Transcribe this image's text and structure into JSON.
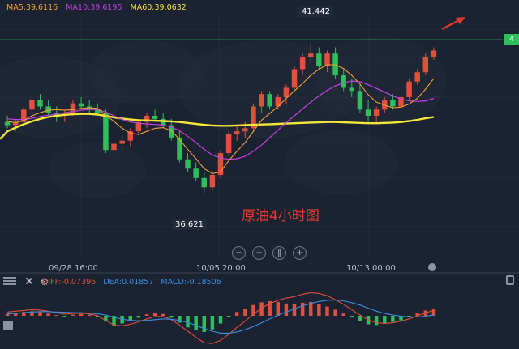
{
  "legend": {
    "ma5": "MA5:39.6116",
    "ma10": "MA10:39.6195",
    "ma60": "MA60:39.0632",
    "colors": {
      "ma5": "#f0a030",
      "ma10": "#c040e0",
      "ma60": "#f5e63a"
    }
  },
  "macd_legend": {
    "diff": "DIFF:-0.07396",
    "dea": "DEA:0.01857",
    "macd": "MACD:-0.18506",
    "colors": {
      "diff": "#e0503a",
      "dea": "#3a8ee0",
      "macd": "#3a8ee0"
    }
  },
  "annotations": {
    "high": "41.442",
    "low": "36.621",
    "title": "原油4小时图",
    "price_tag": "4"
  },
  "x_axis_labels": [
    "09/28 16:00",
    "10/05 20:00",
    "10/13 00:00"
  ],
  "colors": {
    "up": "#e0503a",
    "down": "#2fbf5a",
    "background": "#1b2232",
    "arrow": "#e03a2f"
  },
  "zoom_controls": [
    "−",
    "+",
    "‖",
    "+"
  ],
  "chart_data": {
    "type": "candlestick",
    "ylim": [
      36.0,
      42.2
    ],
    "candles": [
      [
        38.9,
        39.1,
        38.7,
        38.8
      ],
      [
        38.8,
        39.0,
        38.6,
        38.9
      ],
      [
        38.9,
        39.4,
        38.8,
        39.3
      ],
      [
        39.3,
        39.7,
        39.1,
        39.6
      ],
      [
        39.6,
        39.8,
        39.3,
        39.4
      ],
      [
        39.4,
        39.6,
        39.1,
        39.2
      ],
      [
        39.2,
        39.4,
        38.9,
        39.1
      ],
      [
        39.1,
        39.3,
        38.9,
        39.2
      ],
      [
        39.2,
        39.6,
        39.1,
        39.5
      ],
      [
        39.5,
        39.7,
        39.3,
        39.4
      ],
      [
        39.4,
        39.6,
        39.2,
        39.3
      ],
      [
        39.3,
        39.5,
        39.1,
        39.2
      ],
      [
        39.2,
        39.3,
        37.9,
        38.0
      ],
      [
        38.0,
        38.3,
        37.8,
        38.2
      ],
      [
        38.2,
        38.5,
        38.0,
        38.3
      ],
      [
        38.3,
        38.7,
        38.1,
        38.6
      ],
      [
        38.6,
        39.0,
        38.5,
        38.9
      ],
      [
        38.9,
        39.2,
        38.7,
        39.1
      ],
      [
        39.1,
        39.3,
        38.9,
        39.0
      ],
      [
        39.0,
        39.2,
        38.7,
        38.8
      ],
      [
        38.8,
        39.0,
        38.3,
        38.4
      ],
      [
        38.4,
        38.6,
        37.6,
        37.7
      ],
      [
        37.7,
        37.9,
        37.3,
        37.4
      ],
      [
        37.4,
        37.6,
        37.0,
        37.1
      ],
      [
        37.1,
        37.3,
        36.62,
        36.8
      ],
      [
        36.8,
        37.3,
        36.7,
        37.2
      ],
      [
        37.2,
        38.0,
        37.1,
        37.9
      ],
      [
        37.9,
        38.6,
        37.8,
        38.5
      ],
      [
        38.5,
        38.8,
        38.3,
        38.6
      ],
      [
        38.6,
        38.9,
        38.4,
        38.7
      ],
      [
        38.7,
        39.5,
        38.6,
        39.4
      ],
      [
        39.4,
        39.9,
        39.2,
        39.8
      ],
      [
        39.8,
        39.9,
        39.3,
        39.4
      ],
      [
        39.4,
        39.8,
        39.3,
        39.7
      ],
      [
        39.7,
        40.1,
        39.5,
        40.0
      ],
      [
        40.0,
        40.7,
        39.9,
        40.6
      ],
      [
        40.6,
        41.1,
        40.4,
        41.0
      ],
      [
        41.0,
        41.44,
        40.8,
        41.1
      ],
      [
        41.1,
        41.3,
        40.6,
        40.7
      ],
      [
        40.7,
        41.2,
        40.5,
        41.1
      ],
      [
        41.1,
        41.3,
        40.3,
        40.4
      ],
      [
        40.4,
        40.6,
        39.9,
        40.0
      ],
      [
        40.0,
        40.3,
        39.7,
        39.9
      ],
      [
        39.9,
        40.1,
        39.2,
        39.3
      ],
      [
        39.3,
        39.6,
        38.9,
        39.1
      ],
      [
        39.1,
        39.4,
        38.9,
        39.3
      ],
      [
        39.3,
        39.7,
        39.2,
        39.6
      ],
      [
        39.6,
        39.8,
        39.3,
        39.4
      ],
      [
        39.4,
        39.8,
        39.3,
        39.7
      ],
      [
        39.7,
        40.3,
        39.6,
        40.2
      ],
      [
        40.2,
        40.6,
        40.1,
        40.5
      ],
      [
        40.5,
        41.1,
        40.4,
        41.0
      ],
      [
        41.0,
        41.3,
        40.9,
        41.2
      ]
    ],
    "ma5": [
      38.92,
      38.88,
      38.95,
      39.1,
      39.2,
      39.28,
      39.3,
      39.28,
      39.3,
      39.34,
      39.36,
      39.34,
      39.12,
      38.92,
      38.7,
      38.54,
      38.5,
      38.6,
      38.7,
      38.72,
      38.62,
      38.34,
      38.02,
      37.72,
      37.4,
      37.24,
      37.3,
      37.66,
      37.96,
      38.24,
      38.6,
      38.96,
      39.18,
      39.4,
      39.66,
      39.9,
      40.14,
      40.4,
      40.6,
      40.74,
      40.74,
      40.62,
      40.4,
      40.12,
      39.78,
      39.54,
      39.44,
      39.36,
      39.38,
      39.48,
      39.66,
      39.96,
      40.3
    ],
    "ma10": [
      39.0,
      38.98,
      38.98,
      39.02,
      39.08,
      39.12,
      39.16,
      39.2,
      39.24,
      39.28,
      39.3,
      39.3,
      39.22,
      39.1,
      38.98,
      38.9,
      38.86,
      38.84,
      38.82,
      38.8,
      38.74,
      38.62,
      38.44,
      38.24,
      38.02,
      37.84,
      37.74,
      37.7,
      37.72,
      37.8,
      37.96,
      38.16,
      38.4,
      38.64,
      38.88,
      39.1,
      39.32,
      39.54,
      39.74,
      39.92,
      40.06,
      40.16,
      40.22,
      40.2,
      40.1,
      39.98,
      39.86,
      39.74,
      39.64,
      39.58,
      39.56,
      39.58,
      39.66
    ],
    "ma60": [
      38.6,
      38.72,
      38.83,
      38.92,
      39.0,
      39.06,
      39.1,
      39.13,
      39.15,
      39.16,
      39.16,
      39.14,
      39.1,
      39.05,
      39.01,
      38.98,
      38.96,
      38.95,
      38.94,
      38.93,
      38.92,
      38.9,
      38.87,
      38.84,
      38.81,
      38.79,
      38.78,
      38.78,
      38.79,
      38.8,
      38.81,
      38.82,
      38.83,
      38.84,
      38.85,
      38.86,
      38.87,
      38.88,
      38.89,
      38.9,
      38.9,
      38.89,
      38.88,
      38.87,
      38.86,
      38.86,
      38.87,
      38.88,
      38.9,
      38.93,
      38.97,
      39.02,
      39.06
    ],
    "macd_hist": [
      0.05,
      0.08,
      0.1,
      0.12,
      0.1,
      0.06,
      0.02,
      -0.02,
      0.03,
      0.05,
      0.03,
      -0.02,
      -0.15,
      -0.25,
      -0.2,
      -0.12,
      -0.05,
      0.04,
      0.08,
      0.05,
      -0.05,
      -0.18,
      -0.3,
      -0.38,
      -0.42,
      -0.35,
      -0.2,
      -0.02,
      0.1,
      0.18,
      0.28,
      0.35,
      0.38,
      0.36,
      0.32,
      0.3,
      0.34,
      0.36,
      0.3,
      0.24,
      0.16,
      0.06,
      -0.04,
      -0.14,
      -0.22,
      -0.24,
      -0.2,
      -0.16,
      -0.12,
      -0.04,
      0.06,
      0.14,
      0.18
    ],
    "diff": [
      0.1,
      0.12,
      0.14,
      0.16,
      0.15,
      0.12,
      0.08,
      0.04,
      0.06,
      0.07,
      0.05,
      0.0,
      -0.12,
      -0.24,
      -0.26,
      -0.22,
      -0.16,
      -0.08,
      -0.02,
      -0.02,
      -0.1,
      -0.24,
      -0.4,
      -0.56,
      -0.7,
      -0.72,
      -0.64,
      -0.48,
      -0.3,
      -0.14,
      0.04,
      0.2,
      0.32,
      0.4,
      0.46,
      0.5,
      0.56,
      0.6,
      0.58,
      0.52,
      0.42,
      0.3,
      0.16,
      0.02,
      -0.1,
      -0.18,
      -0.2,
      -0.18,
      -0.14,
      -0.08,
      0.0,
      0.08,
      0.14
    ],
    "dea": [
      0.05,
      0.06,
      0.08,
      0.1,
      0.11,
      0.11,
      0.1,
      0.09,
      0.08,
      0.08,
      0.07,
      0.05,
      0.02,
      -0.04,
      -0.09,
      -0.12,
      -0.13,
      -0.12,
      -0.1,
      -0.08,
      -0.09,
      -0.12,
      -0.17,
      -0.25,
      -0.33,
      -0.4,
      -0.45,
      -0.45,
      -0.42,
      -0.36,
      -0.28,
      -0.18,
      -0.08,
      0.02,
      0.1,
      0.18,
      0.26,
      0.32,
      0.37,
      0.4,
      0.41,
      0.39,
      0.34,
      0.28,
      0.2,
      0.12,
      0.06,
      0.02,
      -0.01,
      -0.03,
      -0.03,
      -0.01,
      0.02
    ],
    "macd_ylim": [
      -0.8,
      0.8
    ]
  }
}
